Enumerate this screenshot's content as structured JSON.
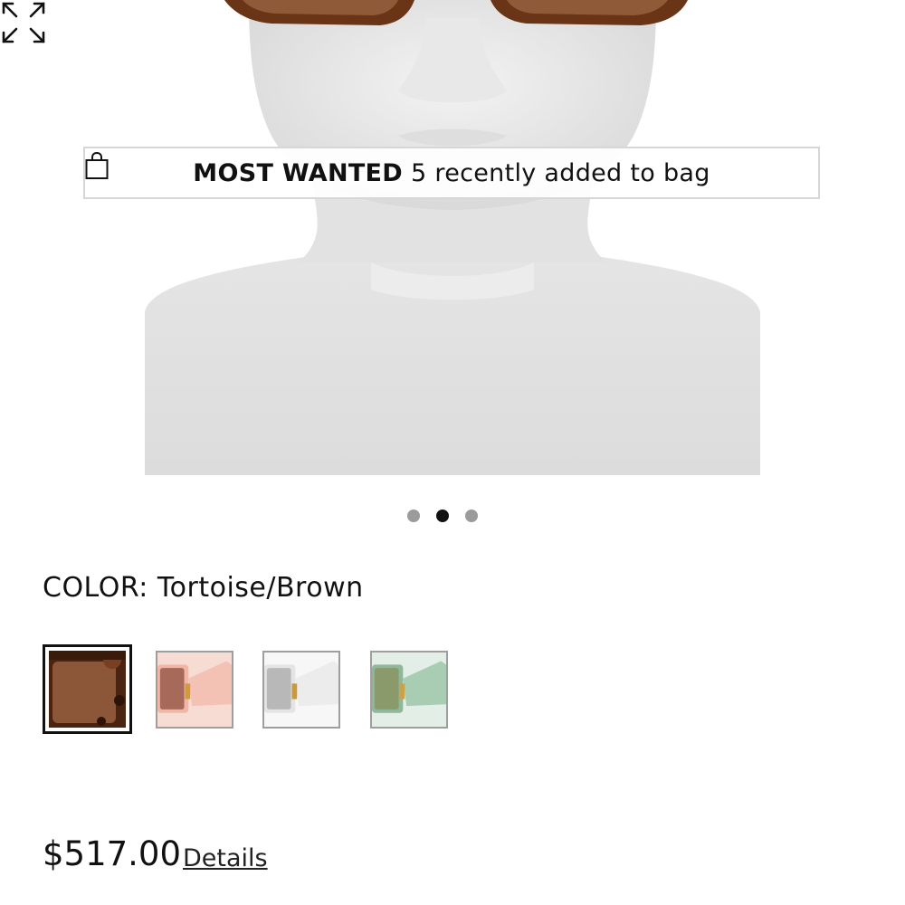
{
  "banner": {
    "icon": "shopping-bag-icon",
    "highlight": "MOST WANTED",
    "text": "5 recently added to bag"
  },
  "gallery": {
    "expand_icon": "expand-arrows-icon",
    "slide_count": 3,
    "active_slide": 2
  },
  "color": {
    "label": "COLOR:",
    "value": "Tortoise/Brown",
    "swatches": [
      {
        "name": "Tortoise/Brown",
        "selected": true,
        "frame_color": "#5a2e17",
        "lens_color": "#8c5638"
      },
      {
        "name": "Pink",
        "selected": false,
        "frame_color": "#f1b6a6",
        "lens_color": "#a7695a"
      },
      {
        "name": "White",
        "selected": false,
        "frame_color": "#eeeeee",
        "lens_color": "#b8b8b8"
      },
      {
        "name": "Green",
        "selected": false,
        "frame_color": "#8fb79c",
        "lens_color": "#8a9a6a"
      }
    ]
  },
  "product": {
    "price": "$517.00",
    "details_link": "Details"
  }
}
